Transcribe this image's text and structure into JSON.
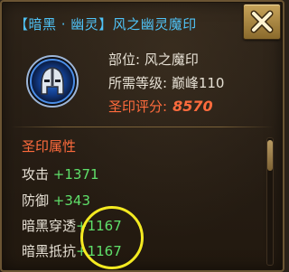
{
  "title": "【暗黑 · 幽灵】风之幽灵魔印",
  "info": {
    "slot_label": "部位:",
    "slot_value": "风之魔印",
    "level_label": "所需等级:",
    "level_value": "巅峰110",
    "score_label": "圣印评分:",
    "score_value": "8570"
  },
  "attributes_title": "圣印属性",
  "attributes": [
    {
      "name": "攻击",
      "value": "+1371"
    },
    {
      "name": "防御",
      "value": "+343"
    },
    {
      "name": "暗黑穿透",
      "value": "+1167"
    },
    {
      "name": "暗黑抵抗",
      "value": "+1167"
    }
  ],
  "icons": {
    "item": "helmet-rune-icon",
    "close": "close-icon"
  },
  "colors": {
    "title": "#4fc3f7",
    "score": "#ff6b3d",
    "bonus": "#5fe06a",
    "highlight": "#f4ea21"
  }
}
